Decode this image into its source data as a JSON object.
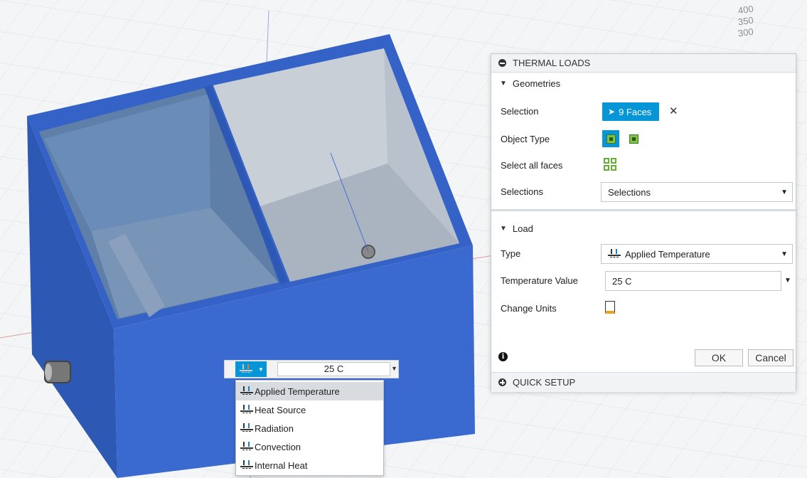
{
  "viewport": {
    "axis_labels": [
      "400",
      "350",
      "300"
    ]
  },
  "panel": {
    "title": "THERMAL LOADS",
    "geometries": {
      "header": "Geometries",
      "selection_label": "Selection",
      "selection_value": "9 Faces",
      "object_type_label": "Object Type",
      "select_all_label": "Select all faces",
      "selections_label": "Selections",
      "selections_value": "Selections"
    },
    "load": {
      "header": "Load",
      "type_label": "Type",
      "type_value": "Applied Temperature",
      "temp_label": "Temperature Value",
      "temp_value": "25 C",
      "units_label": "Change Units"
    },
    "ok_label": "OK",
    "cancel_label": "Cancel",
    "quick_setup": "QUICK SETUP"
  },
  "minibar": {
    "value": "25 C"
  },
  "menu": {
    "items": [
      "Applied Temperature",
      "Heat Source",
      "Radiation",
      "Convection",
      "Internal Heat"
    ],
    "selected": "Applied Temperature"
  },
  "colors": {
    "accent": "#0696d7",
    "model": "#3f67c8",
    "highlight": "#d9dcdf"
  }
}
